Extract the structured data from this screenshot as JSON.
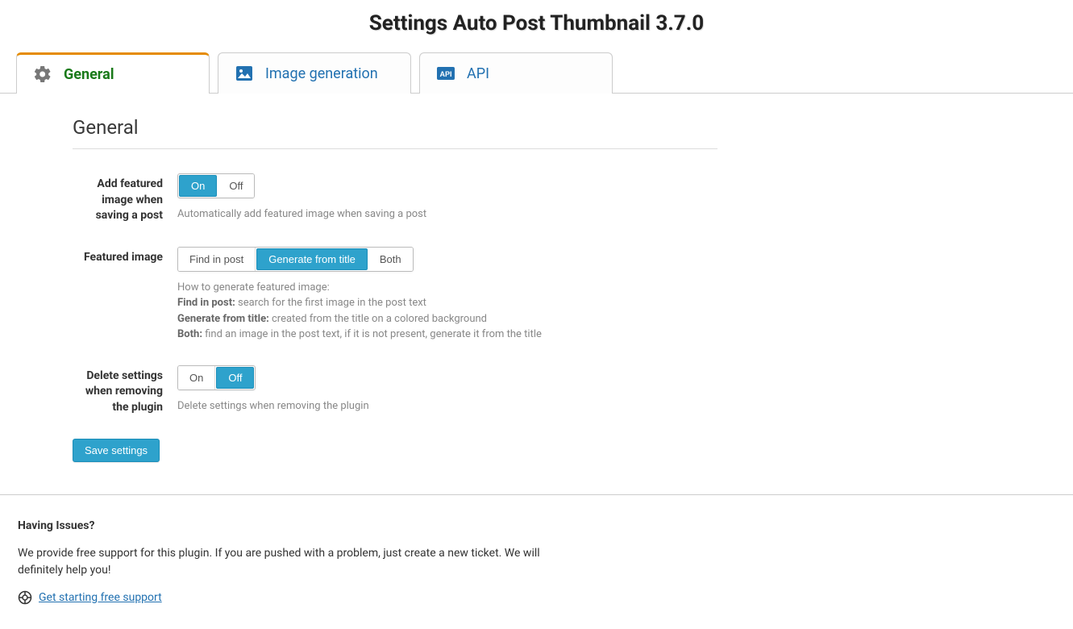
{
  "page_title": "Settings Auto Post Thumbnail 3.7.0",
  "tabs": [
    {
      "label": "General"
    },
    {
      "label": "Image generation"
    },
    {
      "label": "API"
    }
  ],
  "section": {
    "heading": "General"
  },
  "settings": {
    "add_featured": {
      "label": "Add featured image when saving a post",
      "on": "On",
      "off": "Off",
      "help": "Automatically add featured image when saving a post"
    },
    "featured_image": {
      "label": "Featured image",
      "find": "Find in post",
      "generate": "Generate from title",
      "both": "Both",
      "help_intro": "How to generate featured image:",
      "help_find_key": "Find in post:",
      "help_find_val": " search for the first image in the post text",
      "help_gen_key": "Generate from title:",
      "help_gen_val": " created from the title on a colored background",
      "help_both_key": "Both:",
      "help_both_val": " find an image in the post text, if it is not present, generate it from the title"
    },
    "delete_settings": {
      "label": "Delete settings when removing the plugin",
      "on": "On",
      "off": "Off",
      "help": "Delete settings when removing the plugin"
    }
  },
  "save_button": "Save settings",
  "footer": {
    "heading": "Having Issues?",
    "text": "We provide free support for this plugin. If you are pushed with a problem, just create a new ticket. We will definitely help you!",
    "link": "Get starting free support"
  }
}
